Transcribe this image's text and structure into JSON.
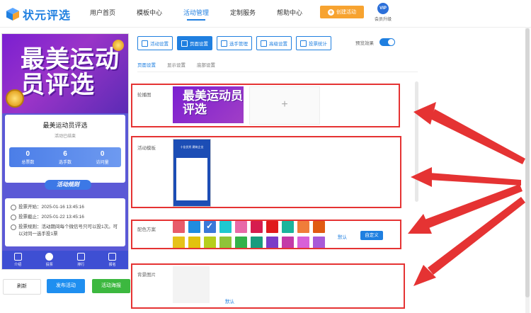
{
  "brand": {
    "name": "状元评选"
  },
  "nav": [
    {
      "label": "用户首页"
    },
    {
      "label": "模板中心"
    },
    {
      "label": "活动管理",
      "active": true
    },
    {
      "label": "定制服务"
    },
    {
      "label": "帮助中心"
    }
  ],
  "header": {
    "create_label": "创建活动",
    "vip_badge": "VIP",
    "vip_label": "会员升级"
  },
  "preview_phone": {
    "banner_title": "最美运动员评选",
    "card_title": "最美运动员评选",
    "status": "活动已结束",
    "stats": [
      {
        "value": "0",
        "label": "总票数"
      },
      {
        "value": "6",
        "label": "选手数"
      },
      {
        "value": "0",
        "label": "访问量"
      }
    ],
    "rules_button": "活动规则",
    "info": [
      {
        "text": "投票开始：2025-01-16 13:45:16"
      },
      {
        "text": "投票截止：2025-01-22 13:45:16"
      },
      {
        "text": "投票规则：活动期间每个微信号只可以投1次。可以对同一选手投1票"
      }
    ],
    "tabs": [
      {
        "label": "介绍"
      },
      {
        "label": "投票",
        "active": true
      },
      {
        "label": "排行"
      },
      {
        "label": "报名"
      }
    ]
  },
  "actions": {
    "refresh": "刷新",
    "publish": "发布活动",
    "poster": "活动海报"
  },
  "toolbar": [
    {
      "label": "活动设置",
      "icon": "gear-icon"
    },
    {
      "label": "页面设置",
      "icon": "page-icon",
      "active": true
    },
    {
      "label": "选手管理",
      "icon": "users-icon"
    },
    {
      "label": "高级设置",
      "icon": "sliders-icon"
    },
    {
      "label": "投票统计",
      "icon": "bar-chart-icon"
    }
  ],
  "preview_toggle": {
    "label": "预览效果",
    "on": true
  },
  "subtabs": [
    {
      "label": "页面设置",
      "active": true
    },
    {
      "label": "显示设置"
    },
    {
      "label": "底部设置"
    }
  ],
  "sections": {
    "carousel": {
      "label": "轮播图",
      "thumb_text": "最美运动员评选"
    },
    "template": {
      "label": "活动模板",
      "thumb_title": "十佳优秀 建筑企业"
    },
    "color_scheme": {
      "label": "配色方案",
      "default_label": "默认",
      "custom_label": "自定义"
    },
    "background": {
      "label": "背景图片",
      "default_label": "默认"
    }
  },
  "colors": {
    "accent": "#1f7fe0",
    "annotation": "#e53333",
    "swatches_row1": [
      "#e85b6a",
      "#1f8ce0",
      "#3a78d8",
      "#1ec8d1",
      "#e86aa8",
      "#d61c4e",
      "#e0191c",
      "#1bb59c",
      "#f07d3a",
      "#e05a12"
    ],
    "swatches_row2": [
      "#e6c21a",
      "#e2c20e",
      "#b6ce1c",
      "#8fc43a",
      "#33b24a",
      "#1a9c7e",
      "#7b3cc8",
      "#c43aa8",
      "#d860d8",
      "#a85ad8"
    ],
    "selected_swatch": 2
  }
}
